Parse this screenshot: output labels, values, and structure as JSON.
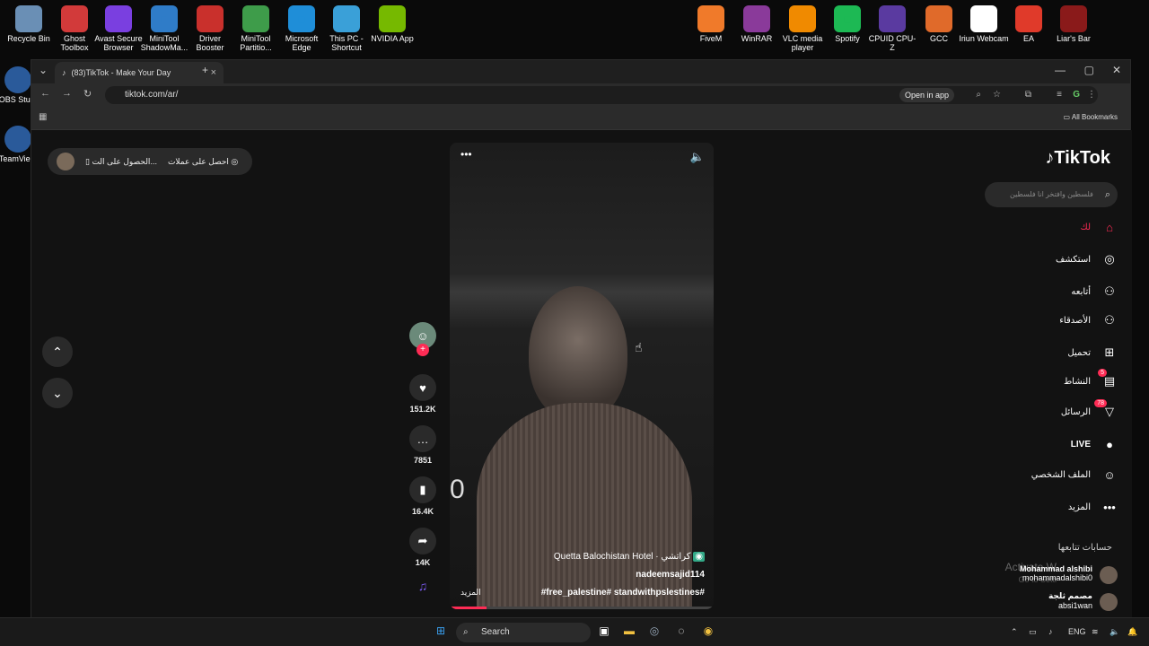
{
  "desktop_icons": [
    {
      "label": "Recycle Bin",
      "icon": "recycle-bin-icon",
      "color": "#6a8fb5"
    },
    {
      "label": "Ghost Toolbox",
      "icon": "ghost-toolbox-icon",
      "color": "#d23a3a"
    },
    {
      "label": "Avast Secure Browser",
      "icon": "avast-icon",
      "color": "#7a3fe0"
    },
    {
      "label": "MiniTool ShadowMa...",
      "icon": "minitool-shadow-icon",
      "color": "#2f7cc8"
    },
    {
      "label": "Driver Booster",
      "icon": "driver-booster-icon",
      "color": "#c9302c"
    },
    {
      "label": "MiniTool Partitio...",
      "icon": "minitool-partition-icon",
      "color": "#3e9c4a"
    },
    {
      "label": "Microsoft Edge",
      "icon": "edge-icon",
      "color": "#1f8ed8"
    },
    {
      "label": "This PC - Shortcut",
      "icon": "this-pc-icon",
      "color": "#3aa0d8"
    },
    {
      "label": "NVIDIA App",
      "icon": "nvidia-icon",
      "color": "#76b900"
    },
    {
      "label": "FiveM",
      "icon": "fivem-icon",
      "color": "#f07a2a"
    },
    {
      "label": "WinRAR",
      "icon": "winrar-icon",
      "color": "#8a3a9a"
    },
    {
      "label": "VLC media player",
      "icon": "vlc-icon",
      "color": "#f08a00"
    },
    {
      "label": "Spotify",
      "icon": "spotify-icon",
      "color": "#1db954"
    },
    {
      "label": "CPUID CPU-Z",
      "icon": "cpuz-icon",
      "color": "#5a3aa0"
    },
    {
      "label": "GCC",
      "icon": "gcc-icon",
      "color": "#e06a2a"
    },
    {
      "label": "Iriun Webcam",
      "icon": "iriun-icon",
      "color": "#ffffff"
    },
    {
      "label": "EA",
      "icon": "ea-icon",
      "color": "#e03a2a"
    },
    {
      "label": "Liar's Bar",
      "icon": "liars-bar-icon",
      "color": "#8a1a1a"
    }
  ],
  "left_desktop_icons": [
    {
      "label": "OBS Stu...",
      "icon": "obs-icon"
    },
    {
      "label": "TeamVie...",
      "icon": "teamviewer-icon"
    }
  ],
  "browser": {
    "tab_title": "(83)TikTok - Make Your Day",
    "url": "tiktok.com/ar/",
    "open_in_app": "Open in app",
    "all_bookmarks": "All Bookmarks",
    "profile_initial": "G"
  },
  "top_pill": {
    "get_coins": "احصل على عملات",
    "get_app": "الحصول على الت..."
  },
  "video": {
    "location": "Quetta Balochistan Hotel · كراتشي",
    "username": "nadeemsajid114",
    "hashtags": "#free_palestine# standwithpslestines#",
    "more": "المزيد",
    "number_overlay": "0",
    "progress": 0.14
  },
  "actions": {
    "likes": "151.2K",
    "comments": "7851",
    "saves": "16.4K",
    "shares": "14K"
  },
  "sidebar": {
    "logo": "TikTok",
    "search_placeholder": "فلسطين وافتخر انا فلسطين",
    "items": [
      {
        "label": "لك",
        "icon": "home-icon"
      },
      {
        "label": "استكشف",
        "icon": "compass-icon"
      },
      {
        "label": "أتابعه",
        "icon": "following-icon"
      },
      {
        "label": "الأصدقاء",
        "icon": "friends-icon"
      },
      {
        "label": "تحميل",
        "icon": "upload-icon"
      },
      {
        "label": "النشاط",
        "icon": "activity-icon",
        "badge": "5"
      },
      {
        "label": "الرسائل",
        "icon": "messages-icon",
        "badge": "78"
      },
      {
        "label": "LIVE",
        "icon": "live-icon"
      },
      {
        "label": "الملف الشخصي",
        "icon": "profile-avatar-icon"
      },
      {
        "label": "المزيد",
        "icon": "more-icon"
      }
    ],
    "following_title": "حسابات تتابعها",
    "accounts": [
      {
        "name": "Mohammad alshibi",
        "handle": "mohammadalshibi0"
      },
      {
        "name": "مصمم ثلجة",
        "handle": "absi1wan"
      }
    ],
    "watermark_line1": "Activate W",
    "watermark_line2": "Go to Setti"
  },
  "taskbar": {
    "search": "Search",
    "lang": "ENG"
  },
  "colors": {
    "accent": "#fe2c55",
    "background": "#121212"
  }
}
